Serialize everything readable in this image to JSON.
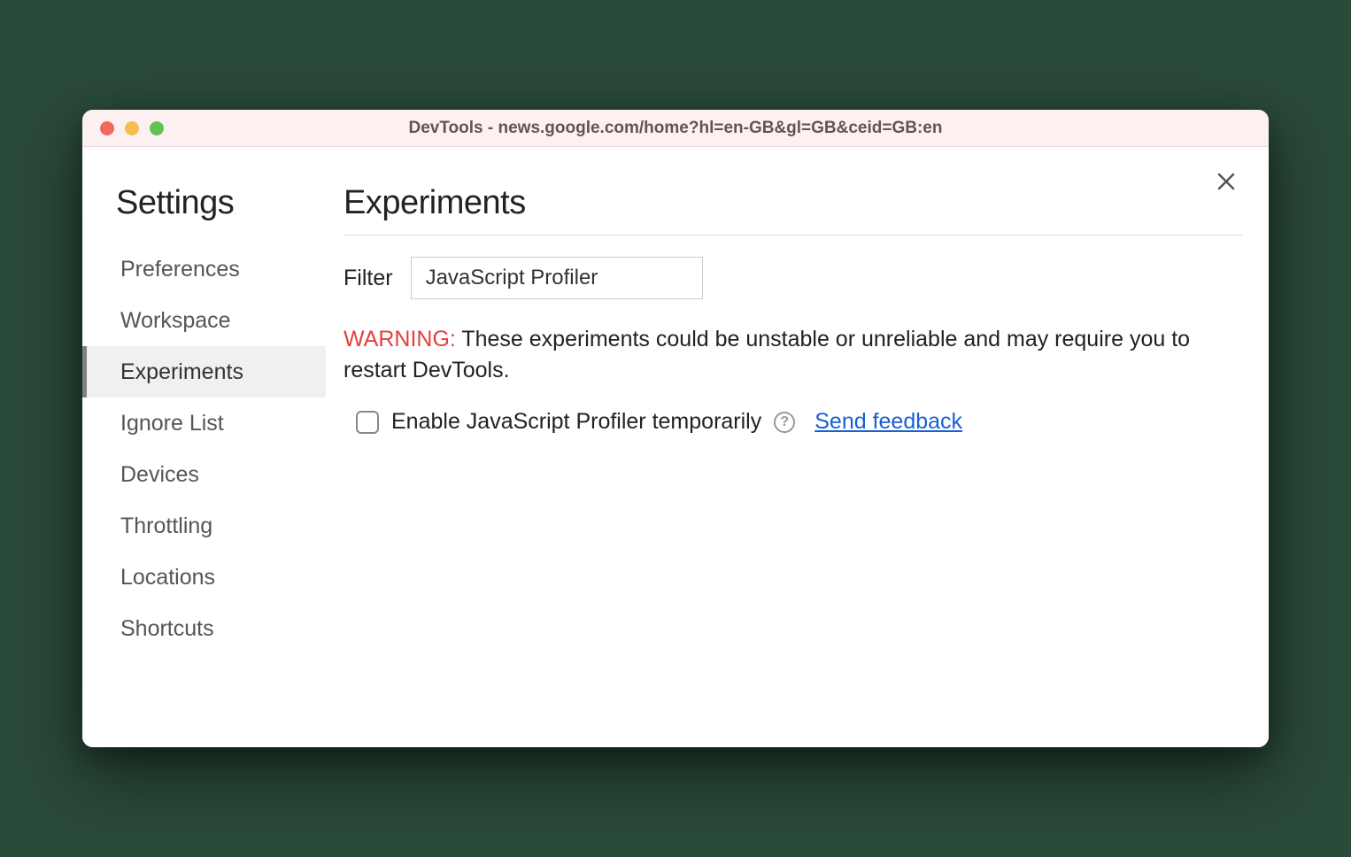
{
  "window": {
    "title": "DevTools - news.google.com/home?hl=en-GB&gl=GB&ceid=GB:en"
  },
  "sidebar": {
    "title": "Settings",
    "items": [
      {
        "label": "Preferences",
        "active": false
      },
      {
        "label": "Workspace",
        "active": false
      },
      {
        "label": "Experiments",
        "active": true
      },
      {
        "label": "Ignore List",
        "active": false
      },
      {
        "label": "Devices",
        "active": false
      },
      {
        "label": "Throttling",
        "active": false
      },
      {
        "label": "Locations",
        "active": false
      },
      {
        "label": "Shortcuts",
        "active": false
      }
    ]
  },
  "main": {
    "title": "Experiments",
    "filter_label": "Filter",
    "filter_value": "JavaScript Profiler",
    "warning_label": "WARNING:",
    "warning_text": " These experiments could be unstable or unreliable and may require you to restart DevTools.",
    "experiment_label": "Enable JavaScript Profiler temporarily",
    "experiment_checked": false,
    "help_symbol": "?",
    "feedback_link": "Send feedback"
  }
}
